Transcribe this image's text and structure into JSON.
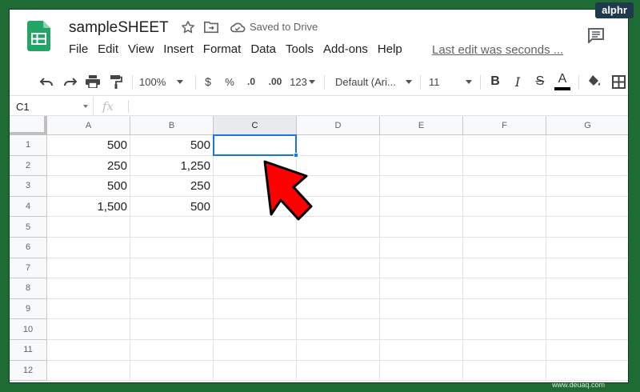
{
  "title": {
    "doc_name": "sampleSHEET",
    "saved_status": "Saved to Drive",
    "last_edit": "Last edit was seconds ..."
  },
  "menu": [
    "File",
    "Edit",
    "View",
    "Insert",
    "Format",
    "Data",
    "Tools",
    "Add-ons",
    "Help"
  ],
  "toolbar": {
    "zoom": "100%",
    "currency": "$",
    "percent": "%",
    "decimal_decrease": ".0",
    "decimal_increase": ".00",
    "more_formats": "123",
    "font": "Default (Ari...",
    "font_size": "11",
    "bold": "B",
    "italic": "I",
    "strikethrough": "S",
    "text_color": "A",
    "text_color_value": "#000000"
  },
  "formula_bar": {
    "cell_ref": "C1",
    "fx": "fx"
  },
  "grid": {
    "columns": [
      "A",
      "B",
      "C",
      "D",
      "E",
      "F",
      "G"
    ],
    "selected_column": "C",
    "rows": [
      "1",
      "2",
      "3",
      "4",
      "5",
      "6",
      "7",
      "8",
      "9",
      "10",
      "11",
      "12"
    ],
    "cells": [
      [
        "500",
        "500"
      ],
      [
        "250",
        "1,250"
      ],
      [
        "500",
        "250"
      ],
      [
        "1,500",
        "500"
      ]
    ],
    "selected_cell": "C1",
    "selection_color": "#1a73e8"
  },
  "annotation": {
    "arrow_color": "#ff0000"
  },
  "watermarks": {
    "brand": "alphr",
    "site": "www.deuaq.com"
  }
}
